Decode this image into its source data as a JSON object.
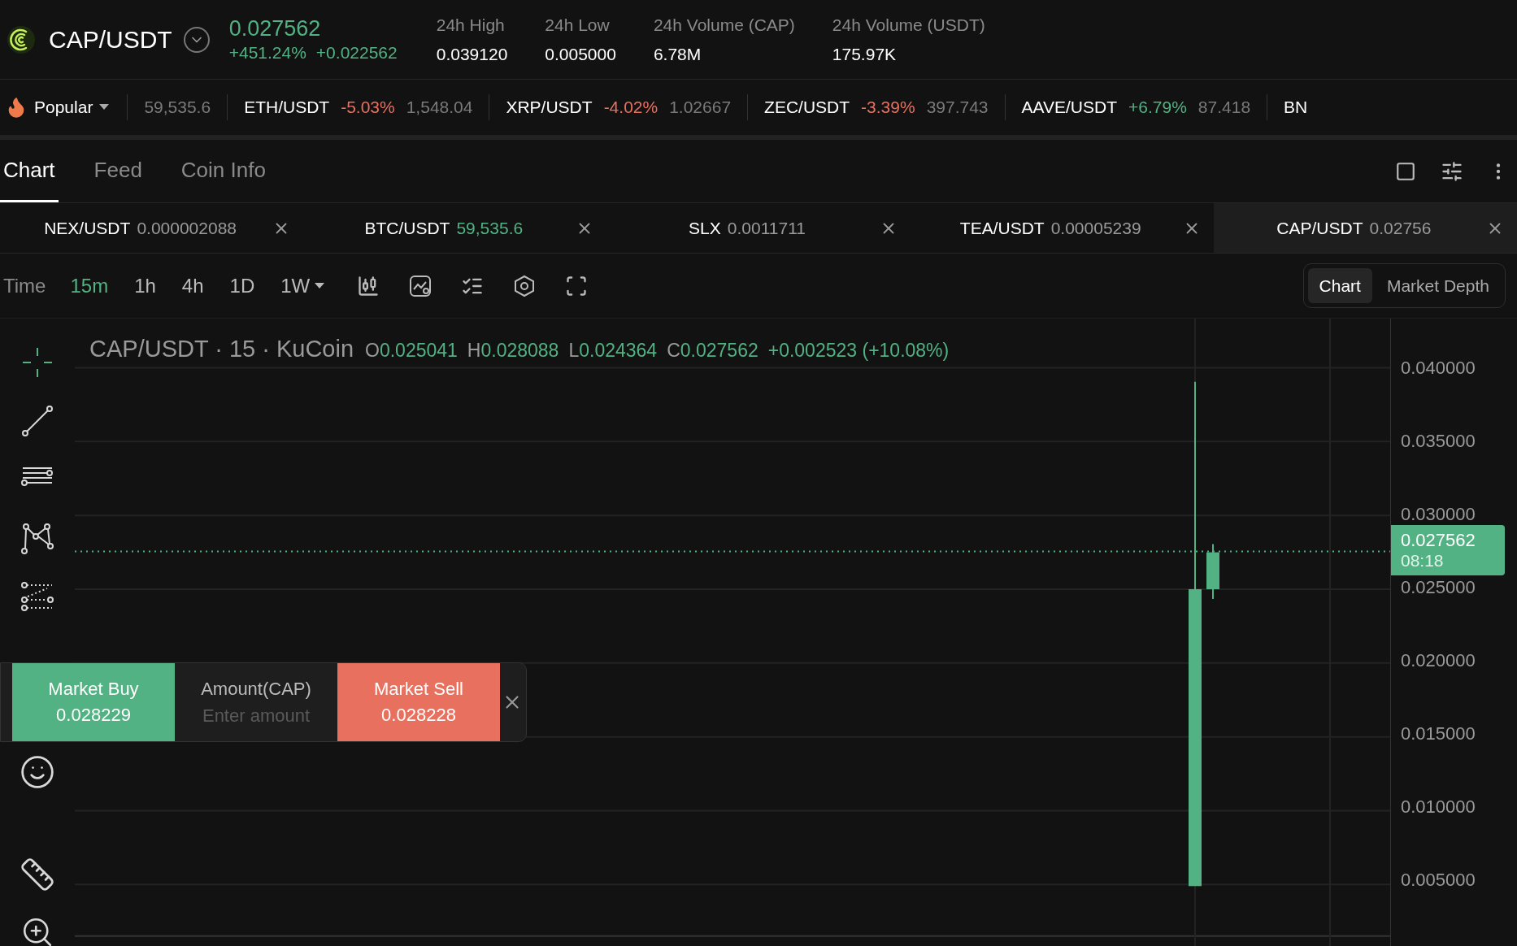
{
  "pair_header": {
    "symbol": "CAP/USDT",
    "price": "0.027562",
    "change_percent": "+451.24%",
    "change_abs": "+0.022562",
    "stats": [
      {
        "label": "24h High",
        "value": "0.039120"
      },
      {
        "label": "24h Low",
        "value": "0.005000"
      },
      {
        "label": "24h Volume (CAP)",
        "value": "6.78M"
      },
      {
        "label": "24h Volume (USDT)",
        "value": "175.97K"
      }
    ]
  },
  "ticker": {
    "category": "Popular",
    "items": [
      {
        "price": "59,535.6"
      },
      {
        "pair": "ETH/USDT",
        "change": "-5.03%",
        "color": "#e8705e",
        "price": "1,548.04"
      },
      {
        "pair": "XRP/USDT",
        "change": "-4.02%",
        "color": "#e8705e",
        "price": "1.02667"
      },
      {
        "pair": "ZEC/USDT",
        "change": "-3.39%",
        "color": "#e8705e",
        "price": "397.743"
      },
      {
        "pair": "AAVE/USDT",
        "change": "+6.79%",
        "color": "#52b283",
        "price": "87.418"
      },
      {
        "pair": "BN"
      }
    ]
  },
  "view_tabs": [
    {
      "label": "Chart",
      "selected": true
    },
    {
      "label": "Feed",
      "selected": false
    },
    {
      "label": "Coin Info",
      "selected": false
    }
  ],
  "pair_tabs": [
    {
      "pair": "NEX/USDT",
      "price": "0.000002088",
      "color": "#9a9a9a",
      "selected": false
    },
    {
      "pair": "BTC/USDT",
      "price": "59,535.6",
      "color": "#52b283",
      "selected": false
    },
    {
      "pair": "SLX",
      "price": "0.0011711",
      "color": "#9a9a9a",
      "selected": false
    },
    {
      "pair": "TEA/USDT",
      "price": "0.00005239",
      "color": "#9a9a9a",
      "selected": false
    },
    {
      "pair": "CAP/USDT",
      "price": "0.02756",
      "color": "#9a9a9a",
      "selected": true
    }
  ],
  "toolbar": {
    "label": "Time",
    "intervals": [
      {
        "label": "15m",
        "selected": true,
        "dropdown": false
      },
      {
        "label": "1h",
        "selected": false,
        "dropdown": false
      },
      {
        "label": "4h",
        "selected": false,
        "dropdown": false
      },
      {
        "label": "1D",
        "selected": false,
        "dropdown": false
      },
      {
        "label": "1W",
        "selected": false,
        "dropdown": true
      }
    ],
    "view_modes": [
      {
        "label": "Chart",
        "selected": true
      },
      {
        "label": "Market Depth",
        "selected": false
      }
    ]
  },
  "chart": {
    "title": "CAP/USDT · 15 · KuCoin",
    "ohlc": [
      {
        "key": "O",
        "value": "0.025041"
      },
      {
        "key": "H",
        "value": "0.028088"
      },
      {
        "key": "L",
        "value": "0.024364"
      },
      {
        "key": "C",
        "value": "0.027562"
      }
    ],
    "change": "+0.002523 (+10.08%)",
    "price_axis": [
      "0.040000",
      "0.035000",
      "0.030000",
      "0.025000",
      "0.020000",
      "0.015000",
      "0.010000",
      "0.005000"
    ],
    "last_price": "0.027562",
    "countdown": "08:18"
  },
  "order_panel": {
    "buy_label": "Market Buy",
    "buy_price": "0.028229",
    "amount_label": "Amount(CAP)",
    "placeholder": "Enter amount",
    "sell_label": "Market Sell",
    "sell_price": "0.028228"
  }
}
